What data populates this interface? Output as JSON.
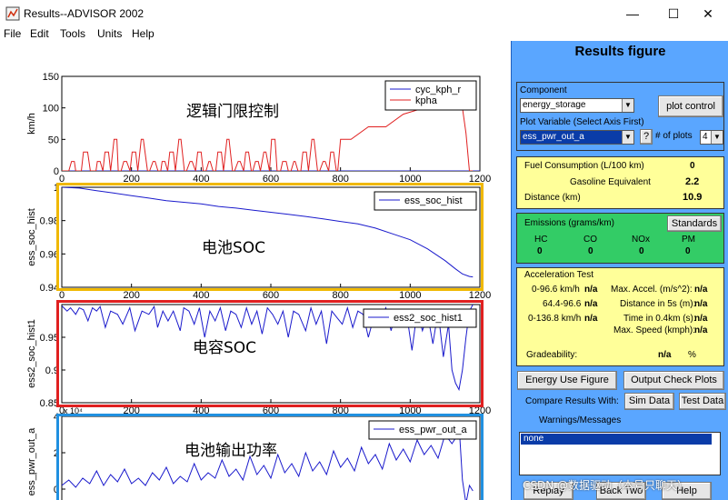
{
  "window": {
    "title": "Results--ADVISOR 2002",
    "min_btn": "—",
    "max_btn": "☐",
    "close_btn": "✕"
  },
  "menu": [
    "File",
    "Edit",
    "Tools",
    "Units",
    "Help"
  ],
  "annotations": [
    {
      "text": "逻辑门限控制",
      "color": "#e8a900"
    },
    {
      "text": "电池SOC",
      "color": "#e8a900"
    },
    {
      "text": "电容SOC",
      "color": "#e02020"
    },
    {
      "text": "电池输出功率",
      "color": "#e02020"
    }
  ],
  "chart_data": [
    {
      "type": "line",
      "ylabel": "km/h",
      "xlim": [
        0,
        1200
      ],
      "ylim": [
        0,
        150
      ],
      "xticks": [
        0,
        200,
        400,
        600,
        800,
        1000,
        1200
      ],
      "yticks": [
        0,
        50,
        100,
        150
      ],
      "legend": [
        "cyc_kph_r",
        "kpha"
      ],
      "legend_position": "top-right",
      "series": [
        {
          "name": "cyc_kph_r",
          "color": "#1a1acc",
          "x": [
            0,
            1000,
            1050,
            1110,
            1140,
            1160,
            1180,
            1200
          ],
          "y": [
            0,
            0,
            0,
            0,
            0,
            0,
            0,
            0
          ]
        },
        {
          "name": "kpha",
          "color": "#e02020",
          "x": [
            0,
            12,
            20,
            28,
            36,
            40,
            48,
            56,
            62,
            74,
            82,
            90,
            98,
            102,
            110,
            118,
            124,
            134,
            140,
            150,
            158,
            162,
            170,
            178,
            186,
            196,
            202,
            212,
            218,
            228,
            234,
            246,
            252,
            262,
            268,
            276,
            284,
            288,
            296,
            304,
            310,
            320,
            326,
            336,
            342,
            352,
            358,
            368,
            374,
            384,
            390,
            400,
            406,
            414,
            422,
            426,
            434,
            442,
            448,
            458,
            464,
            474,
            480,
            490,
            496,
            506,
            512,
            522,
            528,
            536,
            544,
            548,
            556,
            564,
            570,
            580,
            586,
            596,
            602,
            612,
            618,
            628,
            634,
            644,
            650,
            658,
            666,
            670,
            678,
            686,
            692,
            702,
            708,
            718,
            724,
            734,
            740,
            750,
            756,
            766,
            772,
            780,
            788,
            792,
            800,
            830,
            880,
            930,
            980,
            1040,
            1110,
            1135,
            1150,
            1160,
            1170,
            1180
          ],
          "y": [
            0,
            0,
            0,
            15,
            15,
            0,
            0,
            0,
            30,
            30,
            0,
            0,
            0,
            15,
            15,
            0,
            30,
            30,
            0,
            50,
            50,
            0,
            0,
            15,
            15,
            0,
            30,
            30,
            0,
            50,
            50,
            0,
            0,
            15,
            15,
            0,
            0,
            15,
            15,
            0,
            30,
            30,
            0,
            50,
            50,
            0,
            0,
            15,
            15,
            0,
            30,
            30,
            0,
            0,
            15,
            15,
            0,
            0,
            30,
            30,
            0,
            50,
            50,
            0,
            0,
            15,
            15,
            0,
            30,
            30,
            0,
            0,
            15,
            15,
            0,
            30,
            30,
            0,
            50,
            50,
            0,
            0,
            15,
            15,
            0,
            0,
            15,
            15,
            0,
            0,
            30,
            30,
            0,
            50,
            50,
            0,
            0,
            15,
            15,
            0,
            30,
            30,
            0,
            0,
            50,
            50,
            70,
            70,
            90,
            100,
            115,
            120,
            100,
            60,
            0,
            0
          ]
        }
      ]
    },
    {
      "type": "line",
      "ylabel": "ess_soc_hist",
      "xlim": [
        0,
        1200
      ],
      "ylim": [
        0.94,
        1
      ],
      "xticks": [
        0,
        200,
        400,
        600,
        800,
        1000,
        1200
      ],
      "yticks": [
        0.94,
        0.96,
        0.98,
        1
      ],
      "ytick_labels": [
        "0.94",
        "0.96",
        "0.98",
        "1"
      ],
      "legend": [
        "ess_soc_hist"
      ],
      "legend_position": "top-right",
      "series": [
        {
          "name": "ess_soc_hist",
          "color": "#1a1acc",
          "x": [
            0,
            50,
            100,
            150,
            200,
            250,
            300,
            350,
            400,
            450,
            500,
            550,
            600,
            650,
            700,
            750,
            800,
            850,
            900,
            950,
            1000,
            1050,
            1100,
            1130,
            1150,
            1170,
            1180
          ],
          "y": [
            1.0,
            0.9995,
            0.998,
            0.9965,
            0.995,
            0.9935,
            0.992,
            0.991,
            0.99,
            0.9885,
            0.9875,
            0.9862,
            0.985,
            0.9838,
            0.9825,
            0.981,
            0.9795,
            0.978,
            0.9755,
            0.972,
            0.9685,
            0.963,
            0.956,
            0.951,
            0.948,
            0.9465,
            0.9462
          ]
        }
      ]
    },
    {
      "type": "line",
      "ylabel": "ess2_soc_hist1",
      "xlim": [
        0,
        1200
      ],
      "ylim": [
        0.85,
        1
      ],
      "xticks": [
        0,
        200,
        400,
        600,
        800,
        1000,
        1200
      ],
      "yticks": [
        0.85,
        0.9,
        0.95
      ],
      "ytick_labels": [
        "0.85",
        "0.9",
        "0.95"
      ],
      "x_multiplier": "x 10⁴",
      "legend": [
        "ess2_soc_hist1"
      ],
      "legend_position": "top-right",
      "series": [
        {
          "name": "ess2_soc_hist1",
          "color": "#1a1acc",
          "x": [
            0,
            15,
            25,
            40,
            50,
            62,
            75,
            88,
            100,
            110,
            125,
            140,
            160,
            175,
            195,
            210,
            230,
            250,
            265,
            275,
            290,
            305,
            320,
            340,
            350,
            365,
            380,
            395,
            410,
            425,
            440,
            455,
            470,
            485,
            500,
            515,
            530,
            545,
            560,
            575,
            590,
            605,
            620,
            635,
            650,
            665,
            680,
            700,
            715,
            730,
            745,
            760,
            775,
            790,
            805,
            820,
            835,
            850,
            865,
            880,
            900,
            915,
            930,
            945,
            960,
            975,
            990,
            1005,
            1020,
            1035,
            1050,
            1065,
            1080,
            1095,
            1110,
            1120,
            1130,
            1140,
            1150,
            1160,
            1170,
            1180
          ],
          "y": [
            0.998,
            0.99,
            0.995,
            0.985,
            0.995,
            0.992,
            0.975,
            0.995,
            0.99,
            0.997,
            0.965,
            0.99,
            0.985,
            0.97,
            0.995,
            0.96,
            0.99,
            0.985,
            0.997,
            0.965,
            0.99,
            0.975,
            0.99,
            0.96,
            0.995,
            0.99,
            0.97,
            0.995,
            0.95,
            0.99,
            0.975,
            0.995,
            0.96,
            0.99,
            0.985,
            0.965,
            0.995,
            0.97,
            0.99,
            0.955,
            0.995,
            0.985,
            0.97,
            0.99,
            0.95,
            0.99,
            0.985,
            0.96,
            0.995,
            0.97,
            0.99,
            0.94,
            0.99,
            0.98,
            0.97,
            0.995,
            0.965,
            0.99,
            0.985,
            0.95,
            0.99,
            0.975,
            0.995,
            0.96,
            0.99,
            0.97,
            0.985,
            0.93,
            0.99,
            0.96,
            0.985,
            0.94,
            0.99,
            0.92,
            0.97,
            0.9,
            0.88,
            0.87,
            0.9,
            0.95,
            0.99,
            1.0
          ]
        }
      ]
    },
    {
      "type": "line",
      "ylabel": "ess_pwr_out_a",
      "xlim": [
        0,
        1200
      ],
      "ylim": [
        -1,
        4
      ],
      "yticks": [
        0,
        2,
        4
      ],
      "legend": [
        "ess_pwr_out_a"
      ],
      "legend_position": "top-right",
      "series": [
        {
          "name": "ess_pwr_out_a",
          "color": "#1a1acc",
          "x": [
            0,
            20,
            40,
            60,
            80,
            100,
            120,
            140,
            160,
            180,
            200,
            220,
            240,
            260,
            280,
            300,
            320,
            340,
            360,
            380,
            400,
            420,
            440,
            460,
            480,
            500,
            520,
            540,
            560,
            580,
            600,
            620,
            640,
            660,
            680,
            700,
            720,
            740,
            760,
            780,
            800,
            820,
            840,
            860,
            880,
            900,
            920,
            940,
            960,
            980,
            1000,
            1020,
            1040,
            1060,
            1080,
            1100,
            1120,
            1130,
            1140,
            1150,
            1160,
            1170,
            1180
          ],
          "y": [
            0.2,
            0.5,
            0.1,
            0.6,
            0.3,
            1.0,
            0.2,
            0.8,
            0.4,
            1.1,
            0.3,
            0.6,
            0.2,
            0.9,
            0.5,
            1.2,
            0.3,
            0.7,
            0.4,
            1.4,
            0.5,
            0.9,
            0.6,
            1.6,
            0.7,
            1.1,
            0.5,
            1.8,
            0.8,
            1.3,
            0.6,
            1.9,
            0.9,
            1.4,
            0.7,
            2.0,
            1.0,
            1.5,
            0.8,
            2.1,
            1.2,
            1.7,
            1.0,
            2.3,
            1.4,
            1.9,
            1.1,
            2.5,
            1.6,
            2.2,
            1.5,
            2.7,
            1.9,
            2.4,
            1.7,
            3.0,
            2.5,
            2.8,
            3.6,
            0.5,
            -0.8,
            0.2,
            -0.1
          ]
        }
      ]
    }
  ],
  "panel": {
    "title": "Results figure",
    "component_label": "Component",
    "component_value": "energy_storage",
    "plot_control_btn": "plot control",
    "plot_variable_label": "Plot Variable (Select Axis First)",
    "plot_variable_value": "ess_pwr_out_a",
    "help_btn": "?",
    "num_plots_label": "# of plots",
    "num_plots_value": "4",
    "fuel_label": "Fuel Consumption (L/100 km)",
    "fuel_value": "0",
    "gas_equiv_label": "Gasoline Equivalent",
    "gas_equiv_value": "2.2",
    "distance_label": "Distance (km)",
    "distance_value": "10.9",
    "emissions_label": "Emissions (grams/km)",
    "standards_btn": "Standards",
    "emissions": [
      {
        "name": "HC",
        "value": "0"
      },
      {
        "name": "CO",
        "value": "0"
      },
      {
        "name": "NOx",
        "value": "0"
      },
      {
        "name": "PM",
        "value": "0"
      }
    ],
    "accel_label": "Acceleration Test",
    "accel_left": [
      {
        "label": "0-96.6 km/h",
        "value": "n/a"
      },
      {
        "label": "64.4-96.6",
        "value": "n/a"
      },
      {
        "label": "0-136.8 km/h",
        "value": "n/a"
      }
    ],
    "accel_right": [
      {
        "label": "Max. Accel. (m/s^2):",
        "value": "n/a"
      },
      {
        "label": "Distance in 5s (m):",
        "value": "n/a"
      },
      {
        "label": "Time in 0.4km (s):",
        "value": "n/a"
      },
      {
        "label": "Max. Speed (kmph):",
        "value": "n/a"
      }
    ],
    "gradeability_label": "Gradeability:",
    "gradeability_value": "n/a",
    "gradeability_unit": "%",
    "energy_use_btn": "Energy Use Figure",
    "output_check_btn": "Output Check Plots",
    "compare_label": "Compare Results With:",
    "sim_data_btn": "Sim Data",
    "test_data_btn": "Test Data",
    "warnings_label": "Warnings/Messages",
    "warnings_value": "none",
    "replay_btn": "Replay",
    "back_two_btn": "Back Two",
    "help_bottom_btn": "Help"
  },
  "watermark": "CSDN @数据驱动（本号只聊天）"
}
